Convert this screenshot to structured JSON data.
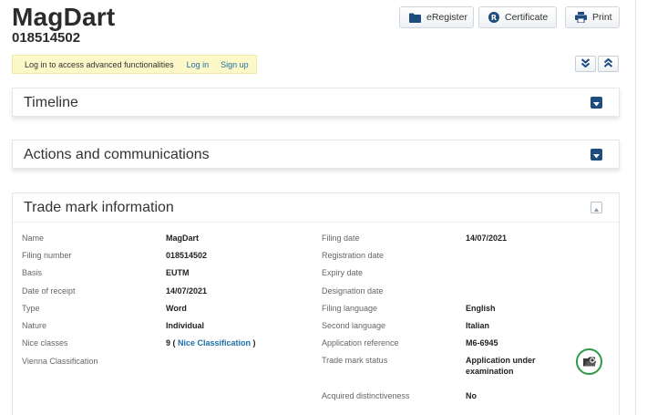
{
  "header": {
    "title": "MagDart",
    "number": "018514502"
  },
  "toolbar": {
    "eregister_label": "eRegister",
    "certificate_label": "Certificate",
    "print_label": "Print"
  },
  "login_bar": {
    "message": "Log in to access advanced functionalities",
    "login_label": "Log in",
    "signup_label": "Sign up"
  },
  "sections": {
    "timeline": "Timeline",
    "actions": "Actions and communications",
    "trademark_info": "Trade mark information"
  },
  "trademark": {
    "left": [
      {
        "label": "Name",
        "value": "MagDart"
      },
      {
        "label": "Filing number",
        "value": "018514502"
      },
      {
        "label": "Basis",
        "value": "EUTM"
      },
      {
        "label": "Date of receipt",
        "value": "14/07/2021"
      },
      {
        "label": "Type",
        "value": "Word"
      },
      {
        "label": "Nature",
        "value": "Individual"
      },
      {
        "label": "Nice classes",
        "value_prefix": "9 ( ",
        "value_link": "Nice Classification",
        "value_suffix": " )"
      },
      {
        "label": "Vienna Classification",
        "value": ""
      }
    ],
    "right": [
      {
        "label": "Filing date",
        "value": "14/07/2021"
      },
      {
        "label": "Registration date",
        "value": ""
      },
      {
        "label": "Expiry date",
        "value": ""
      },
      {
        "label": "Designation date",
        "value": ""
      },
      {
        "label": "Filing language",
        "value": "English"
      },
      {
        "label": "Second language",
        "value": "Italian"
      },
      {
        "label": "Application reference",
        "value": "M6-6945"
      },
      {
        "label": "Trade mark status",
        "value_line1": "Application under",
        "value_line2": "examination"
      },
      {
        "label": "Acquired distinctiveness",
        "value": "No"
      }
    ]
  },
  "colors": {
    "toggle": "#1d4c7d",
    "link": "#1b6ea8",
    "status_ring": "#2d9a4a",
    "login_bar_bg": "#fcf8c8"
  }
}
